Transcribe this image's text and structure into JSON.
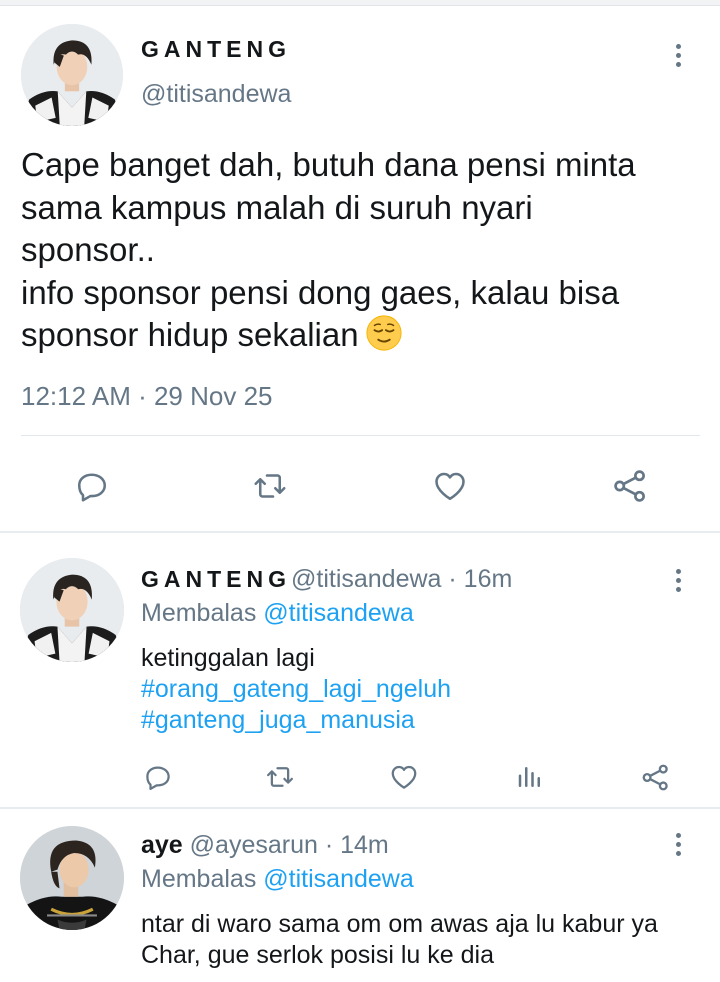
{
  "main_tweet": {
    "display_name": "GANTENG",
    "handle": "@titisandewa",
    "text": "Cape banget dah, butuh dana pensi minta\nsama kampus malah di suruh nyari\nsponsor..\ninfo sponsor pensi dong gaes, kalau bisa\nsponsor hidup sekalian",
    "emoji": "relieved-face",
    "time": "12:12 AM",
    "date": "29 Nov 25",
    "meta_separator": " · ",
    "actions": [
      "reply-icon",
      "retweet-icon",
      "like-icon",
      "share-icon"
    ]
  },
  "replies": [
    {
      "display_name": "GANTENG",
      "handle": "@titisandewa",
      "age": "16m",
      "separator": " · ",
      "replying_prefix": "Membalas",
      "replying_to": "@titisandewa",
      "body": "ketinggalan lagi",
      "hashtags": [
        "#orang_gateng_lagi_ngeluh",
        "#ganteng_juga_manusia"
      ],
      "actions": [
        "reply-icon",
        "retweet-icon",
        "like-icon",
        "analytics-icon",
        "share-icon"
      ]
    },
    {
      "display_name": "aye",
      "handle": "@ayesarun",
      "age": "14m",
      "separator": " · ",
      "replying_prefix": "Membalas",
      "replying_to": "@titisandewa",
      "body": "ntar di waro sama om om awas aja lu kabur ya Char, gue serlok posisi lu ke dia"
    }
  ],
  "colors": {
    "text": "#14171a",
    "secondary": "#657786",
    "link": "#1da1f2",
    "divider": "#e6ecf0"
  }
}
